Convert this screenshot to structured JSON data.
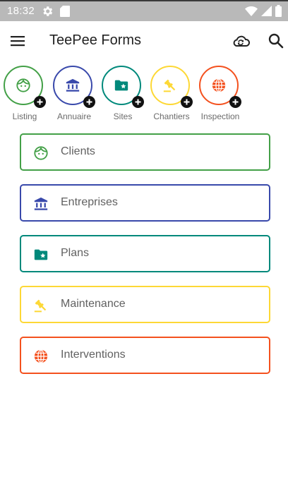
{
  "status_bar": {
    "time": "18:32",
    "icons": [
      "settings-gear-icon",
      "sd-card-icon",
      "wifi-icon",
      "signal-icon",
      "battery-icon"
    ]
  },
  "app_bar": {
    "title": "TeePee Forms",
    "icons": [
      "menu-icon",
      "cloud-sync-icon",
      "search-icon"
    ]
  },
  "quick_actions": [
    {
      "label": "Listing",
      "icon": "face-icon",
      "color": "#43a047"
    },
    {
      "label": "Annuaire",
      "icon": "bank-icon",
      "color": "#3949ab"
    },
    {
      "label": "Sites",
      "icon": "folder-star-icon",
      "color": "#00897b"
    },
    {
      "label": "Chantiers",
      "icon": "gavel-icon",
      "color": "#fdd835"
    },
    {
      "label": "Inspection",
      "icon": "globe-icon",
      "color": "#f4511e"
    }
  ],
  "cards": [
    {
      "label": "Clients",
      "icon": "face-icon",
      "color": "#43a047"
    },
    {
      "label": "Entreprises",
      "icon": "bank-icon",
      "color": "#3949ab"
    },
    {
      "label": "Plans",
      "icon": "folder-star-icon",
      "color": "#00897b"
    },
    {
      "label": "Maintenance",
      "icon": "gavel-icon",
      "color": "#fdd835"
    },
    {
      "label": "Interventions",
      "icon": "globe-icon",
      "color": "#f4511e"
    }
  ],
  "colors": {
    "status_bar": "#b9b9b9",
    "listing": "#43a047",
    "annuaire": "#3949ab",
    "sites": "#00897b",
    "chantiers": "#fdd835",
    "inspection": "#f4511e"
  }
}
